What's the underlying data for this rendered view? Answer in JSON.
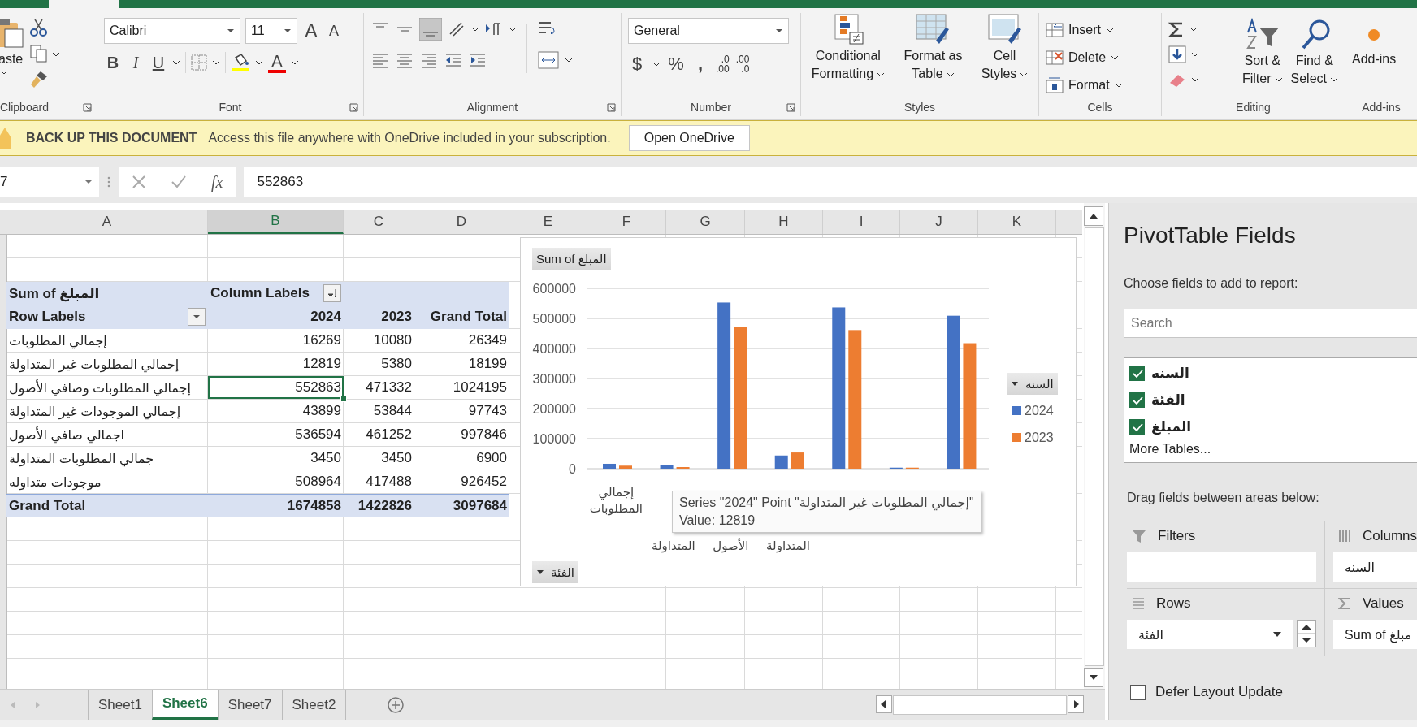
{
  "ribbon": {
    "clipboard": {
      "paste_label": "aste",
      "group_label": "Clipboard"
    },
    "font": {
      "name": "Calibri",
      "size": "11",
      "grow": "A",
      "shrink": "A",
      "bold": "B",
      "italic": "I",
      "underline": "U",
      "color_glyph": "A",
      "group_label": "Font"
    },
    "alignment": {
      "group_label": "Alignment"
    },
    "number": {
      "format": "General",
      "currency": "$",
      "percent": "%",
      "comma": ",",
      "decimals": [
        {
          "top": ".0",
          "bottom": ".00"
        },
        {
          "top": ".00",
          "bottom": ".0"
        }
      ],
      "group_label": "Number"
    },
    "styles": {
      "buttons": [
        {
          "kind": "conditional",
          "lines": [
            "Conditional",
            "Formatting"
          ]
        },
        {
          "kind": "table",
          "lines": [
            "Format as",
            "Table"
          ]
        },
        {
          "kind": "cell",
          "lines": [
            "Cell",
            "Styles"
          ]
        }
      ],
      "group_label": "Styles"
    },
    "cells": {
      "buttons": [
        {
          "kind": "insert",
          "label": "Insert"
        },
        {
          "kind": "delete",
          "label": "Delete"
        },
        {
          "kind": "format",
          "label": "Format"
        }
      ],
      "group_label": "Cells"
    },
    "editing": {
      "buttons": [
        {
          "kind": "sort",
          "lines": [
            "Sort &",
            "Filter"
          ]
        },
        {
          "kind": "find",
          "lines": [
            "Find &",
            "Select"
          ]
        }
      ],
      "group_label": "Editing"
    },
    "addins": {
      "button": "Add-ins",
      "group_label": "Add-ins"
    }
  },
  "message_bar": {
    "title": "BACK UP THIS DOCUMENT",
    "text": "Access this file anywhere with OneDrive included in your subscription.",
    "button": "Open OneDrive"
  },
  "formula_bar": {
    "name_box": "7",
    "function_label": "fx",
    "formula": "552863"
  },
  "columns": [
    {
      "label": "A",
      "selected": false
    },
    {
      "label": "B",
      "selected": true
    },
    {
      "label": "C",
      "selected": false
    },
    {
      "label": "D",
      "selected": false
    },
    {
      "label": "E",
      "selected": false
    },
    {
      "label": "F",
      "selected": false
    },
    {
      "label": "G",
      "selected": false
    },
    {
      "label": "H",
      "selected": false
    },
    {
      "label": "I",
      "selected": false
    },
    {
      "label": "J",
      "selected": false
    },
    {
      "label": "K",
      "selected": false
    }
  ],
  "pivot": {
    "value_field": "Sum of المبلغ",
    "column_labels": "Column Labels",
    "row_labels": "Row Labels",
    "headers": [
      "2024",
      "2023",
      "Grand Total"
    ],
    "rows": [
      {
        "label": "إجمالي المطلوبات",
        "cells": [
          {
            "text": "16269",
            "selected": false
          },
          {
            "text": "10080",
            "selected": false
          },
          {
            "text": "26349",
            "selected": false
          }
        ]
      },
      {
        "label": "إجمالي المطلوبات غير المتداولة",
        "cells": [
          {
            "text": "12819",
            "selected": false
          },
          {
            "text": "5380",
            "selected": false
          },
          {
            "text": "18199",
            "selected": false
          }
        ]
      },
      {
        "label": "إجمالي المطلوبات وصافي الأصول",
        "cells": [
          {
            "text": "552863",
            "selected": true
          },
          {
            "text": "471332",
            "selected": false
          },
          {
            "text": "1024195",
            "selected": false
          }
        ]
      },
      {
        "label": "إجمالي الموجودات غير المتداولة",
        "cells": [
          {
            "text": "43899",
            "selected": false
          },
          {
            "text": "53844",
            "selected": false
          },
          {
            "text": "97743",
            "selected": false
          }
        ]
      },
      {
        "label": "اجمالي صافي الأصول",
        "cells": [
          {
            "text": "536594",
            "selected": false
          },
          {
            "text": "461252",
            "selected": false
          },
          {
            "text": "997846",
            "selected": false
          }
        ]
      },
      {
        "label": "جمالي المطلوبات المتداولة",
        "cells": [
          {
            "text": "3450",
            "selected": false
          },
          {
            "text": "3450",
            "selected": false
          },
          {
            "text": "6900",
            "selected": false
          }
        ]
      },
      {
        "label": "موجودات متداوله",
        "cells": [
          {
            "text": "508964",
            "selected": false
          },
          {
            "text": "417488",
            "selected": false
          },
          {
            "text": "926452",
            "selected": false
          }
        ]
      }
    ],
    "grand_total": {
      "label": "Grand Total",
      "values": [
        "1674858",
        "1422826",
        "3097684"
      ]
    }
  },
  "chart": {
    "value_button": "Sum of المبلغ",
    "legend_button": "السنه",
    "axis_button": "الفئة",
    "chart_data": {
      "type": "bar",
      "categories": [
        "إجمالي المطلوبات",
        "المتداولة",
        "الأصول",
        "المتداولة",
        null,
        null,
        null
      ],
      "series": [
        {
          "name": "2024",
          "color": "#4472c4",
          "values": [
            16269,
            12819,
            552863,
            43899,
            536594,
            3450,
            508964
          ]
        },
        {
          "name": "2023",
          "color": "#ed7d31",
          "values": [
            10080,
            5380,
            471332,
            53844,
            461252,
            3450,
            417488
          ]
        }
      ],
      "ylim": [
        0,
        600000
      ],
      "grid": true,
      "legend": true,
      "yticks": [
        0,
        100000,
        200000,
        300000,
        400000,
        500000,
        600000
      ]
    },
    "tooltip": {
      "line1": "Series \"2024\" Point \"إجمالي المطلوبات غير المتداولة\"",
      "line2": "Value: 12819"
    }
  },
  "pane": {
    "title": "PivotTable Fields",
    "subtitle": "Choose fields to add to report:",
    "search_placeholder": "Search",
    "fields": [
      {
        "label": "السنه",
        "checked": true
      },
      {
        "label": "الفئة",
        "checked": true
      },
      {
        "label": "المبلغ",
        "checked": true
      }
    ],
    "more_tables": "More Tables...",
    "drag_hint": "Drag fields between areas below:",
    "areas": [
      {
        "kind": "filters",
        "label": "Filters"
      },
      {
        "kind": "columns",
        "label": "Columns",
        "item": "السنه"
      },
      {
        "kind": "rows",
        "label": "Rows",
        "item": "الفئة"
      },
      {
        "kind": "values",
        "label": "Values",
        "item": "Sum of مبلغ"
      }
    ],
    "defer": {
      "label": "Defer Layout Update",
      "checked": false
    }
  },
  "sheet_tabs": [
    {
      "label": "Sheet1",
      "selected": false
    },
    {
      "label": "Sheet6",
      "selected": true
    },
    {
      "label": "Sheet7",
      "selected": false
    },
    {
      "label": "Sheet2",
      "selected": false
    }
  ]
}
